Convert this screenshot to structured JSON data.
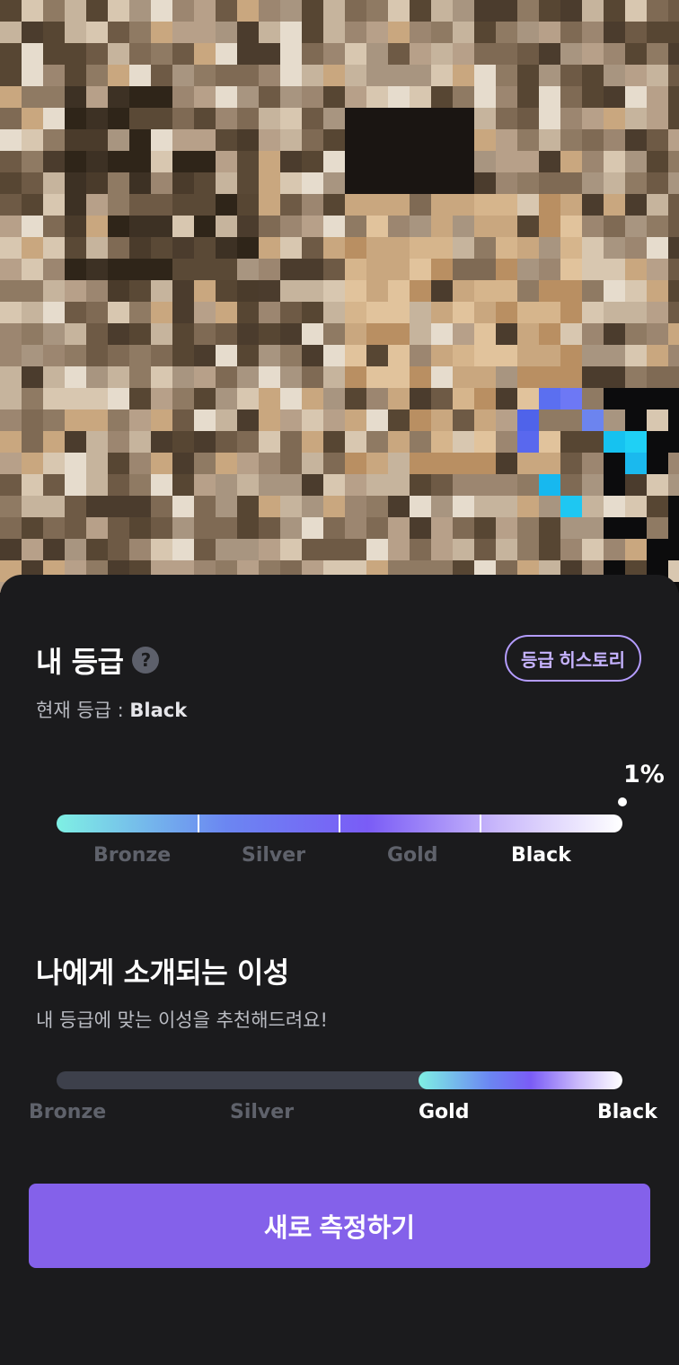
{
  "grade_section": {
    "title": "내 등급",
    "help_icon": "?",
    "history_button": "등급 히스토리",
    "current_label": "현재 등급 : ",
    "current_value": "Black",
    "percentile": "1%",
    "tiers": [
      "Bronze",
      "Silver",
      "Gold",
      "Black"
    ],
    "active_tier": "Black"
  },
  "intro_section": {
    "title": "나에게 소개되는 이성",
    "subtitle": "내 등급에 맞는 이성을 추천해드려요!",
    "tiers": [
      "Bronze",
      "Silver",
      "Gold",
      "Black"
    ],
    "highlighted_tiers": [
      "Gold",
      "Black"
    ],
    "range_fraction": 0.36
  },
  "measure_button": "새로 측정하기",
  "colors": {
    "accent": "#8461ea",
    "background": "#1b1b1d",
    "history_border": "#b49cff"
  }
}
